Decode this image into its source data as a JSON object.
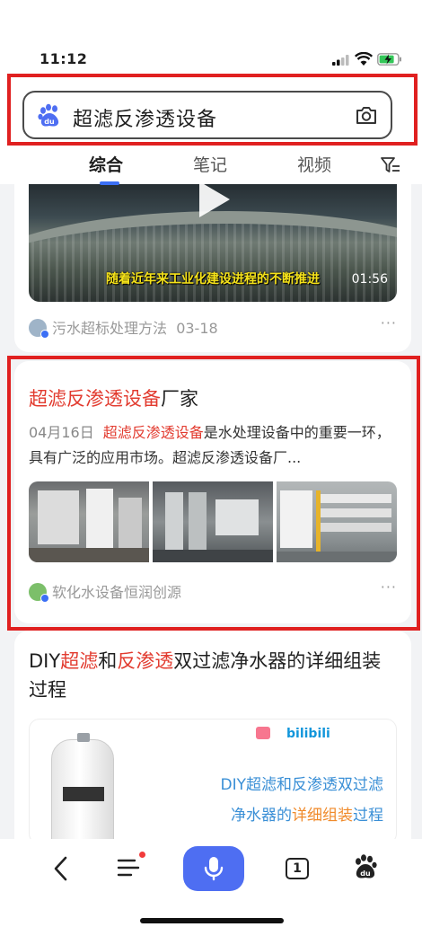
{
  "status_bar": {
    "time": "11:12"
  },
  "search": {
    "query": "超滤反渗透设备"
  },
  "tabs": [
    {
      "label": "综合",
      "active": true
    },
    {
      "label": "笔记",
      "active": false
    },
    {
      "label": "视频",
      "active": false
    }
  ],
  "result1": {
    "video_subtitle": "随着近年来工业化建设进程的不断推进",
    "duration": "01:56",
    "source": "污水超标处理方法",
    "date": "03-18",
    "more": "···"
  },
  "result2": {
    "title_highlight": "超滤反渗透设备",
    "title_rest": "厂家",
    "date": "04月16日",
    "snippet_highlight": "超滤反渗透设备",
    "snippet_rest": "是水处理设备中的重要一环，具有广泛的应用市场。超滤反渗透设备厂...",
    "source": "软化水设备恒润创源",
    "more": "···"
  },
  "result3": {
    "title_parts": [
      "DIY",
      "超滤",
      "和",
      "反渗透",
      "双过滤净水器的详细组装过程"
    ],
    "thumb_brand": "bilibili",
    "thumb_line1": "DIY超滤和反渗透双过滤",
    "thumb_line2_a": "净水器的",
    "thumb_line2_b": "详细组装",
    "thumb_line2_c": "过程"
  },
  "bottom_nav": {
    "tab_count": "1",
    "icons": [
      "back-icon",
      "menu-icon",
      "microphone-icon",
      "tabs-icon",
      "baidu-paw-icon"
    ]
  },
  "colors": {
    "accent": "#4e6ef2",
    "highlight": "#e23b2f",
    "annotation_frame": "#e02020"
  }
}
